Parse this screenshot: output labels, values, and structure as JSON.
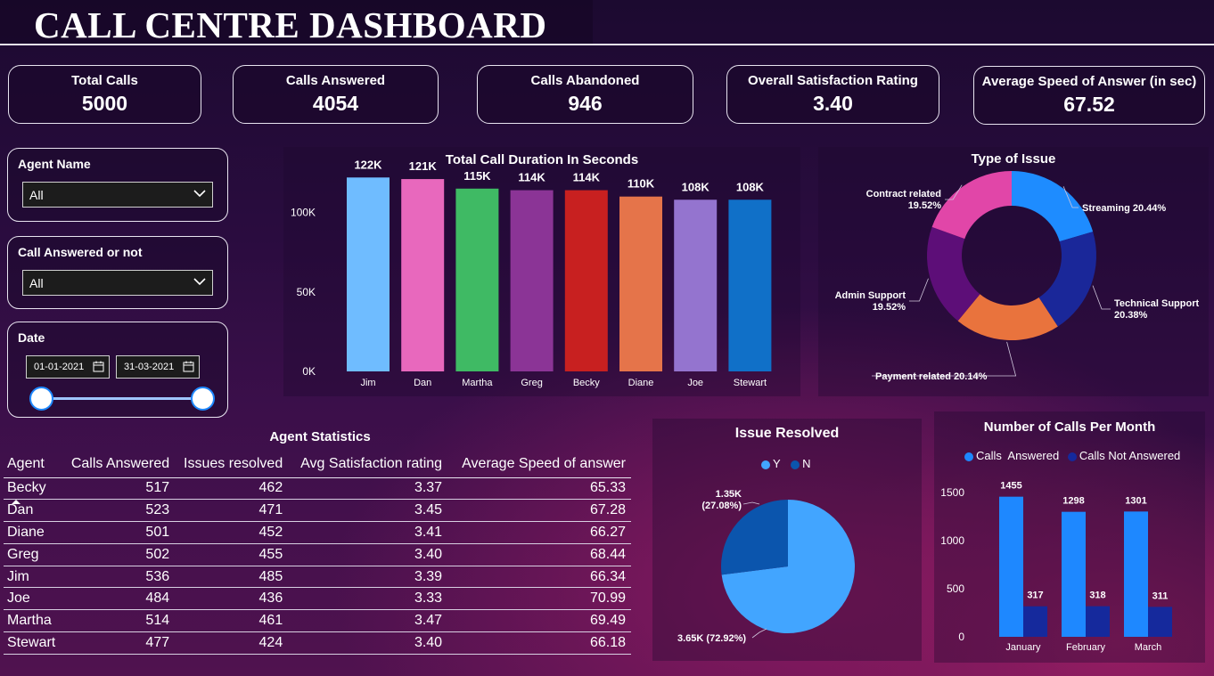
{
  "header": {
    "title": "CALL CENTRE DASHBOARD"
  },
  "kpis": [
    {
      "label": "Total Calls",
      "value": "5000"
    },
    {
      "label": "Calls Answered",
      "value": "4054"
    },
    {
      "label": "Calls Abandoned",
      "value": "946"
    },
    {
      "label": "Overall Satisfaction Rating",
      "value": "3.40"
    },
    {
      "label": "Average Speed of Answer (in sec)",
      "value": "67.52"
    }
  ],
  "filters": {
    "agent_name": {
      "label": "Agent Name",
      "value": "All"
    },
    "call_answered": {
      "label": "Call Answered or not",
      "value": "All"
    },
    "date": {
      "label": "Date",
      "start": "01-01-2021",
      "end": "31-03-2021"
    }
  },
  "colors": {
    "accent_blue": "#1e88ff",
    "dark_blue": "#15299c",
    "resolved_y": "#42a5ff",
    "resolved_n": "#0b55ad"
  },
  "chart_data": [
    {
      "id": "duration",
      "type": "bar",
      "title": "Total Call Duration In Seconds",
      "categories": [
        "Jim",
        "Dan",
        "Martha",
        "Greg",
        "Becky",
        "Diane",
        "Joe",
        "Stewart"
      ],
      "values": [
        122000,
        121000,
        115000,
        114000,
        114000,
        110000,
        108000,
        108000
      ],
      "data_labels": [
        "122K",
        "121K",
        "115K",
        "114K",
        "114K",
        "110K",
        "108K",
        "108K"
      ],
      "colors": [
        "#6fbcff",
        "#e868bd",
        "#3fba64",
        "#8b3496",
        "#c82020",
        "#e5744a",
        "#9474cf",
        "#1070c8"
      ],
      "yticks": [
        0,
        50000,
        100000
      ],
      "ytick_labels": [
        "0K",
        "50K",
        "100K"
      ],
      "ylim": [
        0,
        130000
      ]
    },
    {
      "id": "issue_type",
      "type": "pie",
      "title": "Type of Issue",
      "labels": [
        "Streaming",
        "Technical Support",
        "Payment related",
        "Admin Support",
        "Contract related"
      ],
      "values": [
        20.44,
        20.38,
        20.14,
        19.52,
        19.52
      ],
      "display": [
        "Streaming 20.44%",
        "Technical Support 20.38%",
        "Payment related 20.14%",
        "Admin Support 19.52%",
        "Contract related 19.52%"
      ],
      "colors": [
        "#1e8cff",
        "#1a2799",
        "#e9733d",
        "#5d0e78",
        "#e146a8"
      ]
    },
    {
      "id": "resolved",
      "type": "pie",
      "title": "Issue Resolved",
      "legend": [
        "Y",
        "N"
      ],
      "labels": [
        "Y",
        "N"
      ],
      "values": [
        3650,
        1350
      ],
      "display": [
        "3.65K (72.92%)",
        "1.35K (27.08%)"
      ],
      "colors": [
        "#42a5ff",
        "#0b55ad"
      ]
    },
    {
      "id": "monthly",
      "type": "bar",
      "title": "Number of Calls Per Month",
      "categories": [
        "January",
        "February",
        "March"
      ],
      "series": [
        {
          "name": "Calls  Answered",
          "values": [
            1455,
            1298,
            1301
          ]
        },
        {
          "name": "Calls Not Answered",
          "values": [
            317,
            318,
            311
          ]
        }
      ],
      "colors": [
        "#1e88ff",
        "#15299c"
      ],
      "yticks": [
        0,
        500,
        1000,
        1500
      ],
      "ylim": [
        0,
        1600
      ]
    }
  ],
  "agent_table": {
    "title": "Agent Statistics",
    "columns": [
      "Agent",
      "Calls Answered",
      "Issues resolved",
      "Avg Satisfaction rating",
      "Average Speed of answer"
    ],
    "rows": [
      [
        "Becky",
        "517",
        "462",
        "3.37",
        "65.33"
      ],
      [
        "Dan",
        "523",
        "471",
        "3.45",
        "67.28"
      ],
      [
        "Diane",
        "501",
        "452",
        "3.41",
        "66.27"
      ],
      [
        "Greg",
        "502",
        "455",
        "3.40",
        "68.44"
      ],
      [
        "Jim",
        "536",
        "485",
        "3.39",
        "66.34"
      ],
      [
        "Joe",
        "484",
        "436",
        "3.33",
        "70.99"
      ],
      [
        "Martha",
        "514",
        "461",
        "3.47",
        "69.49"
      ],
      [
        "Stewart",
        "477",
        "424",
        "3.40",
        "66.18"
      ]
    ]
  }
}
